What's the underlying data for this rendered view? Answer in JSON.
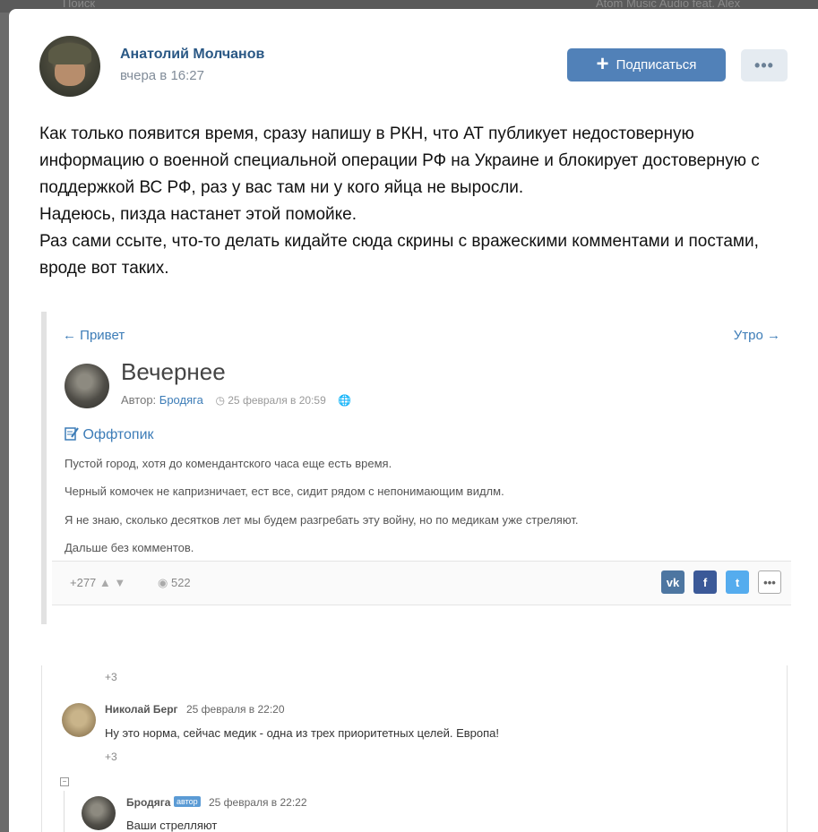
{
  "background_bar": {
    "left": "Поиск",
    "right": "Atom Music Audio feat. Alex"
  },
  "post": {
    "author": "Анатолий Молчанов",
    "time": "вчера в 16:27",
    "subscribe_label": "Подписаться",
    "more_label": "•••",
    "paragraphs": [
      "Как только появится время, сразу напишу в РКН, что АТ публикует недостоверную информацию о военной специальной операции РФ на Украине и блокирует достоверную с поддержкой ВС РФ, раз у вас там ни у кого яйца не выросли.",
      "Надеюсь, пизда настанет этой помойке.",
      "Раз сами ссыте, что-то делать кидайте сюда скрины с вражескими комментами и постами, вроде вот таких."
    ]
  },
  "screenshot1": {
    "nav_prev": "← Привет",
    "nav_next": "Утро →",
    "title": "Вечернее",
    "author_prefix": "Автор:",
    "author": "Бродяга",
    "date": "◷ 25 февраля в 20:59",
    "globe": "🌐",
    "category": "Оффтопик",
    "lines": [
      "Пустой город, хотя до комендантского часа еще есть время.",
      "Черный комочек не капризничает, ест все, сидит рядом с непонимающим видлм.",
      "Я не знаю, сколько десятков лет мы будем разгребать эту войну, но по медикам уже стреляют.",
      "Дальше без комментов."
    ],
    "score": "+277",
    "views": "522",
    "share": {
      "vk": "vk",
      "fb": "f",
      "tw": "t",
      "more": "•••"
    }
  },
  "screenshot2": {
    "top_plus": "+3",
    "comment1": {
      "author": "Николай Берг",
      "date": "25 февраля в 22:20",
      "text": "Ну это норма, сейчас медик - одна из трех приоритетных целей. Европа!",
      "plus": "+3"
    },
    "collapse": "−",
    "comment2": {
      "author": "Бродяга",
      "badge": "автор",
      "date": "25 февраля в 22:22",
      "text": "Ваши стрелляют"
    }
  }
}
